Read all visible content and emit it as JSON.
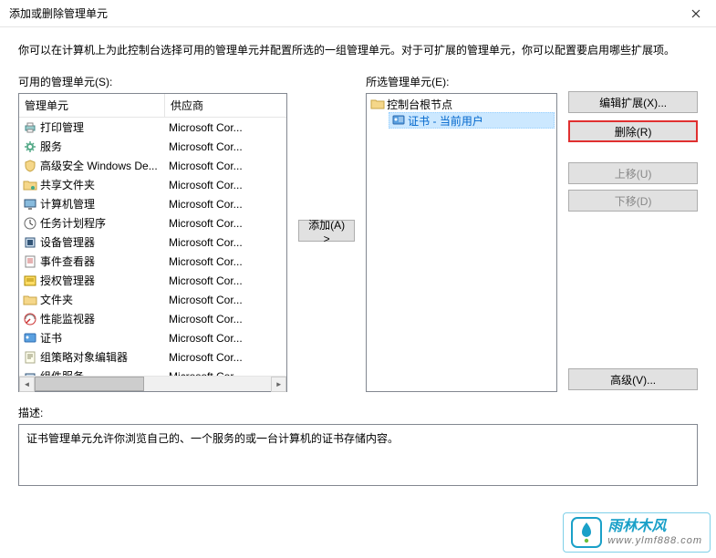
{
  "titlebar": {
    "title": "添加或删除管理单元"
  },
  "top_desc": "你可以在计算机上为此控制台选择可用的管理单元并配置所选的一组管理单元。对于可扩展的管理单元，你可以配置要启用哪些扩展项。",
  "available": {
    "label": "可用的管理单元(S):",
    "col1": "管理单元",
    "col2": "供应商",
    "rows": [
      {
        "icon": "printer-icon",
        "name": "打印管理",
        "vendor": "Microsoft Cor..."
      },
      {
        "icon": "gear-icon",
        "name": "服务",
        "vendor": "Microsoft Cor..."
      },
      {
        "icon": "shield-icon",
        "name": "高级安全 Windows De...",
        "vendor": "Microsoft Cor..."
      },
      {
        "icon": "folder-share-icon",
        "name": "共享文件夹",
        "vendor": "Microsoft Cor..."
      },
      {
        "icon": "monitor-icon",
        "name": "计算机管理",
        "vendor": "Microsoft Cor..."
      },
      {
        "icon": "clock-icon",
        "name": "任务计划程序",
        "vendor": "Microsoft Cor..."
      },
      {
        "icon": "device-icon",
        "name": "设备管理器",
        "vendor": "Microsoft Cor..."
      },
      {
        "icon": "event-icon",
        "name": "事件查看器",
        "vendor": "Microsoft Cor..."
      },
      {
        "icon": "auth-icon",
        "name": "授权管理器",
        "vendor": "Microsoft Cor..."
      },
      {
        "icon": "folder-icon",
        "name": "文件夹",
        "vendor": "Microsoft Cor..."
      },
      {
        "icon": "perf-icon",
        "name": "性能监视器",
        "vendor": "Microsoft Cor..."
      },
      {
        "icon": "cert-icon",
        "name": "证书",
        "vendor": "Microsoft Cor..."
      },
      {
        "icon": "policy-icon",
        "name": "组策略对象编辑器",
        "vendor": "Microsoft Cor..."
      },
      {
        "icon": "component-icon",
        "name": "组件服务",
        "vendor": "Microsoft Cor..."
      }
    ]
  },
  "selected": {
    "label": "所选管理单元(E):",
    "root": "控制台根节点",
    "child": "证书 - 当前用户"
  },
  "buttons": {
    "add": "添加(A) >",
    "edit_ext": "编辑扩展(X)...",
    "remove": "删除(R)",
    "move_up": "上移(U)",
    "move_down": "下移(D)",
    "advanced": "高级(V)..."
  },
  "description": {
    "label": "描述:",
    "text": "证书管理单元允许你浏览自己的、一个服务的或一台计算机的证书存储内容。"
  },
  "watermark": {
    "line1": "雨林木风",
    "line2": "www.ylmf888.com"
  }
}
